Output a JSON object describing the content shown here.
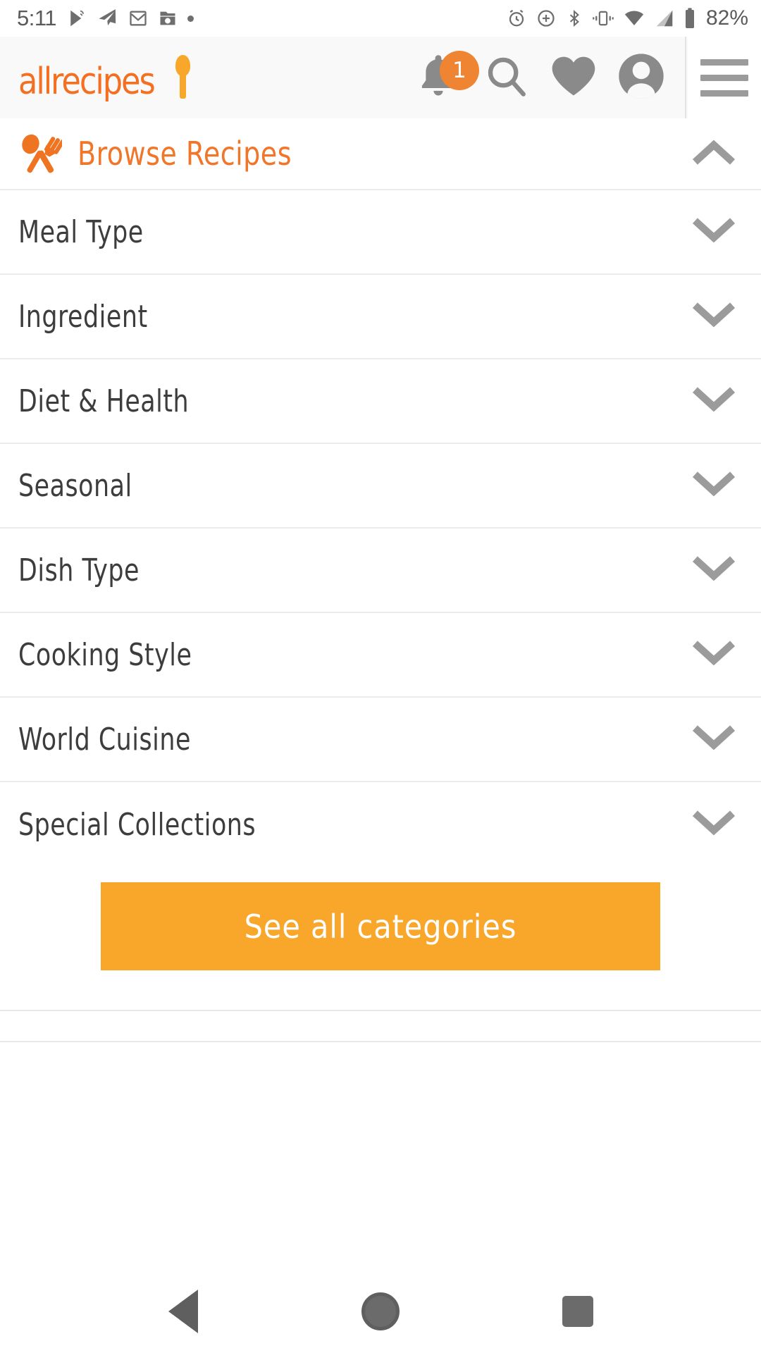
{
  "status_bar": {
    "time": "5:11",
    "battery_percent": "82%",
    "left_icons": [
      "cast-icon",
      "telegram-icon",
      "gmail-icon",
      "folder-download-icon",
      "dot-icon"
    ],
    "right_icons": [
      "alarm-icon",
      "location-add-icon",
      "bluetooth-icon",
      "vibrate-icon",
      "wifi-icon",
      "cell-signal-icon",
      "battery-icon"
    ]
  },
  "header": {
    "logo_text": "allrecipes",
    "logo_icon": "spoon-icon",
    "notification_count": "1",
    "icons": {
      "bell": "bell-icon",
      "search": "search-icon",
      "favorites": "heart-icon",
      "profile": "avatar-icon",
      "menu": "hamburger-menu-icon"
    },
    "colors": {
      "logo_orange": "#f36f21",
      "spoon_orange": "#f9a72b",
      "badge_orange": "#ef8432",
      "icon_gray": "#8a8a8a",
      "background": "#f9f9f9"
    }
  },
  "browse": {
    "label": "Browse Recipes",
    "icon": "spoon-fork-icon",
    "chevron": "chevron-up-icon",
    "expanded": true,
    "accent_color": "#f0762a"
  },
  "categories": [
    {
      "label": "Meal Type",
      "chevron": "chevron-down-icon"
    },
    {
      "label": "Ingredient",
      "chevron": "chevron-down-icon"
    },
    {
      "label": "Diet & Health",
      "chevron": "chevron-down-icon"
    },
    {
      "label": "Seasonal",
      "chevron": "chevron-down-icon"
    },
    {
      "label": "Dish Type",
      "chevron": "chevron-down-icon"
    },
    {
      "label": "Cooking Style",
      "chevron": "chevron-down-icon"
    },
    {
      "label": "World Cuisine",
      "chevron": "chevron-down-icon"
    },
    {
      "label": "Special Collections",
      "chevron": "chevron-down-icon"
    }
  ],
  "cta": {
    "label": "See all categories",
    "background_color": "#f9a72b",
    "text_color": "#ffffff"
  },
  "nav_bar": {
    "back": "back-triangle-icon",
    "home": "home-circle-icon",
    "recents": "recents-square-icon"
  }
}
